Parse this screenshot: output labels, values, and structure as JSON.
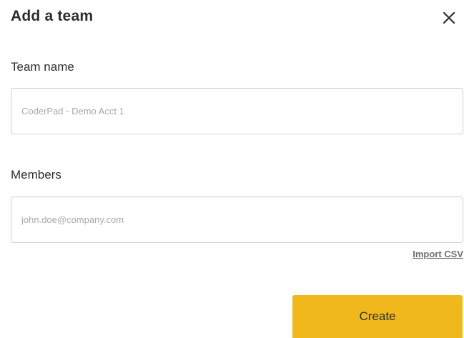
{
  "dialog": {
    "title": "Add a team",
    "close_icon": "close-icon"
  },
  "team_name": {
    "label": "Team name",
    "value": "",
    "placeholder": "CoderPad - Demo Acct 1"
  },
  "members": {
    "label": "Members",
    "value": "",
    "placeholder": "john.doe@company.com",
    "import_label": "Import CSV"
  },
  "actions": {
    "create_label": "Create"
  },
  "colors": {
    "accent": "#f0b81c",
    "text": "#2d2d2d",
    "border": "#cfcfcf",
    "placeholder": "#a8a8a8",
    "link": "#6e6e6e"
  }
}
